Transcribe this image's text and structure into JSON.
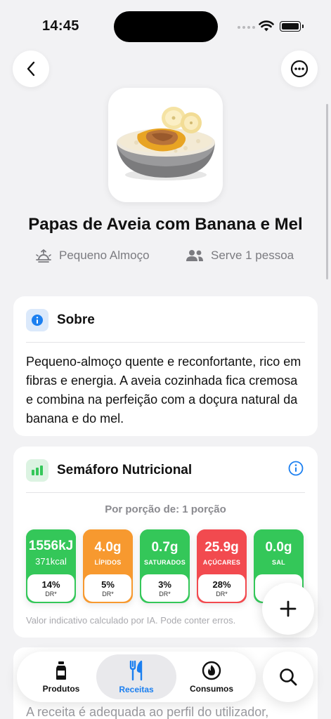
{
  "status_bar": {
    "time": "14:45"
  },
  "recipe": {
    "title": "Papas de Aveia com Banana e Mel",
    "category": "Pequeno Almoço",
    "servings": "Serve 1 pessoa"
  },
  "about": {
    "title": "Sobre",
    "text": "Pequeno-almoço quente e reconfortante, rico em fibras e energia. A aveia cozinhada fica cremosa e combina na perfeição com a doçura natural da banana e do mel."
  },
  "nutrition": {
    "title": "Semáforo Nutricional",
    "portion": "Por porção de: 1 porção",
    "tiles": [
      {
        "value": "1556kJ",
        "sub": "371kcal",
        "label": "",
        "pct": "14%",
        "dr": "DR*",
        "color": "#34c759"
      },
      {
        "value": "4.0g",
        "sub": "",
        "label": "LÍPIDOS",
        "pct": "5%",
        "dr": "DR*",
        "color": "#f7992f"
      },
      {
        "value": "0.7g",
        "sub": "",
        "label": "SATURADOS",
        "pct": "3%",
        "dr": "DR*",
        "color": "#34c759"
      },
      {
        "value": "25.9g",
        "sub": "",
        "label": "AÇÚCARES",
        "pct": "28%",
        "dr": "DR*",
        "color": "#f24a4f"
      },
      {
        "value": "0.0g",
        "sub": "",
        "label": "SAL",
        "pct": "0",
        "dr": "",
        "color": "#34c759"
      }
    ],
    "disclaimer": "Valor indicativo calculado por IA. Pode conter erros."
  },
  "next_card": {
    "text": "A receita é adequada ao perfil do utilizador,"
  },
  "tabbar": {
    "products": "Produtos",
    "recipes": "Receitas",
    "consumption": "Consumos"
  },
  "colors": {
    "accent": "#1b7ff0",
    "green": "#34c759",
    "orange": "#f7992f",
    "red": "#f24a4f"
  }
}
